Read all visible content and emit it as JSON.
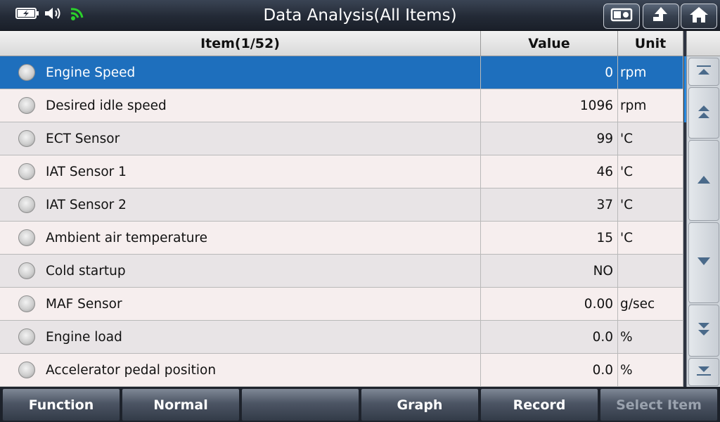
{
  "header": {
    "title": "Data Analysis(All Items)",
    "icons": [
      "battery-charging-icon",
      "speaker-icon",
      "wifi-icon"
    ],
    "buttons": [
      "screenshot-icon",
      "back-icon",
      "home-icon"
    ]
  },
  "table": {
    "headers": {
      "item": "Item(1/52)",
      "value": "Value",
      "unit": "Unit"
    },
    "rows": [
      {
        "item": "Engine Speed",
        "value": "0",
        "unit": "rpm",
        "selected": true
      },
      {
        "item": "Desired idle speed",
        "value": "1096",
        "unit": "rpm"
      },
      {
        "item": "ECT Sensor",
        "value": "99",
        "unit": "'C"
      },
      {
        "item": "IAT Sensor 1",
        "value": "46",
        "unit": "'C"
      },
      {
        "item": "IAT Sensor 2",
        "value": "37",
        "unit": "'C"
      },
      {
        "item": "Ambient air temperature",
        "value": "15",
        "unit": "'C"
      },
      {
        "item": "Cold startup",
        "value": "NO",
        "unit": ""
      },
      {
        "item": "MAF Sensor",
        "value": "0.00",
        "unit": "g/sec"
      },
      {
        "item": "Engine load",
        "value": "0.0",
        "unit": "%"
      },
      {
        "item": "Accelerator pedal position",
        "value": "0.0",
        "unit": "%"
      }
    ]
  },
  "nav": [
    "scroll-top-icon",
    "page-up-icon",
    "line-up-icon",
    "line-down-icon",
    "page-down-icon",
    "scroll-bottom-icon"
  ],
  "footer": {
    "function": "Function",
    "normal": "Normal",
    "empty": "",
    "graph": "Graph",
    "record": "Record",
    "select_item": "Select Item"
  },
  "colors": {
    "selected_row": "#1e6fbd",
    "wifi": "#2bd12b"
  }
}
